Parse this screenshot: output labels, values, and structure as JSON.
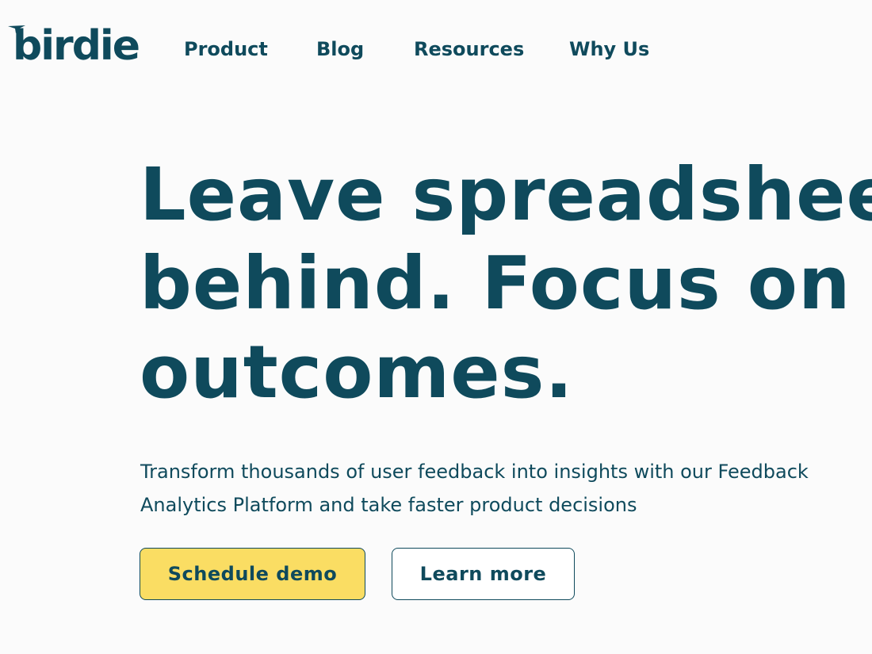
{
  "header": {
    "logo_text": "birdie",
    "nav": [
      {
        "label": "Product"
      },
      {
        "label": "Blog"
      },
      {
        "label": "Resources"
      },
      {
        "label": "Why Us"
      }
    ]
  },
  "hero": {
    "title_lines": [
      "Leave spreadsheets",
      "behind. Focus on the",
      "outcomes."
    ],
    "subtitle_lines": [
      "Transform thousands of user feedback into insights with our Feedback",
      "Analytics Platform and take faster product decisions"
    ],
    "primary_button": "Schedule demo",
    "secondary_button": "Learn more"
  },
  "colors": {
    "brand": "#0f4a5c",
    "accent": "#fadd63",
    "background": "#fbfbfb"
  },
  "icons": {
    "logo_mark": "bird-icon"
  }
}
